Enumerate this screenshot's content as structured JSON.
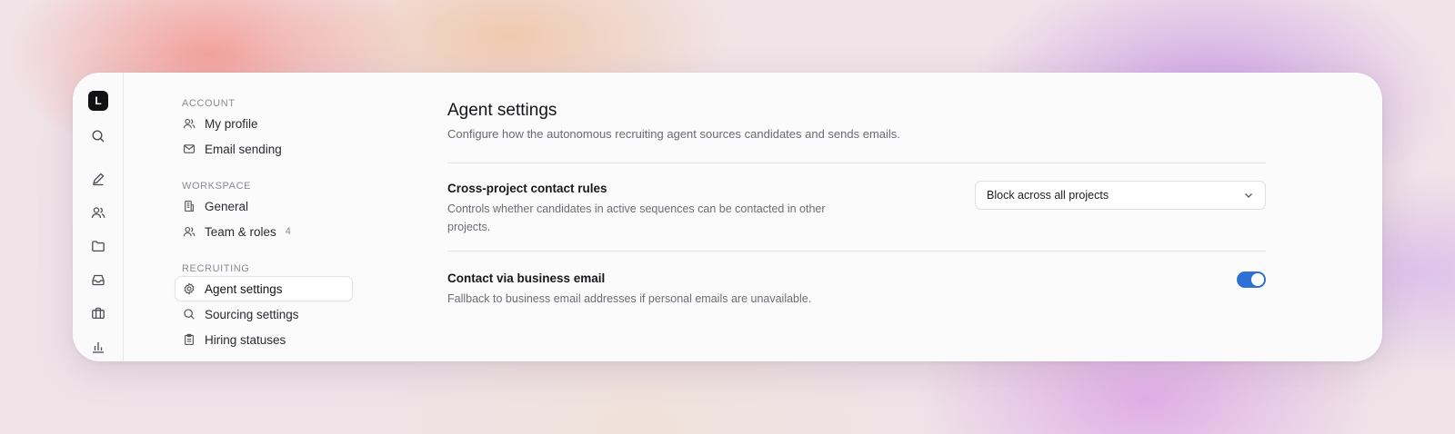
{
  "rail": {
    "logo_letter": "L",
    "icons": [
      "search-icon",
      "pencil-icon",
      "users-icon",
      "folder-icon",
      "inbox-icon",
      "briefcase-icon",
      "bar-chart-icon"
    ]
  },
  "nav": {
    "account_section": "ACCOUNT",
    "my_profile": "My profile",
    "email_sending": "Email sending",
    "workspace_section": "WORKSPACE",
    "general": "General",
    "team_roles": "Team & roles",
    "team_roles_count": "4",
    "recruiting_section": "RECRUITING",
    "agent_settings": "Agent settings",
    "sourcing_settings": "Sourcing settings",
    "hiring_statuses": "Hiring statuses"
  },
  "main": {
    "title": "Agent settings",
    "subtitle": "Configure how the autonomous recruiting agent sources candidates and sends emails.",
    "contact_rules": {
      "title": "Cross-project contact rules",
      "description": "Controls whether candidates in active sequences can be contacted in other projects.",
      "selected_option": "Block across all projects"
    },
    "business_email": {
      "title": "Contact via business email",
      "description": "Fallback to business email addresses if personal emails are unavailable.",
      "enabled": true
    }
  },
  "colors": {
    "accent": "#2f6fd6",
    "logo_bg": "#121214"
  }
}
